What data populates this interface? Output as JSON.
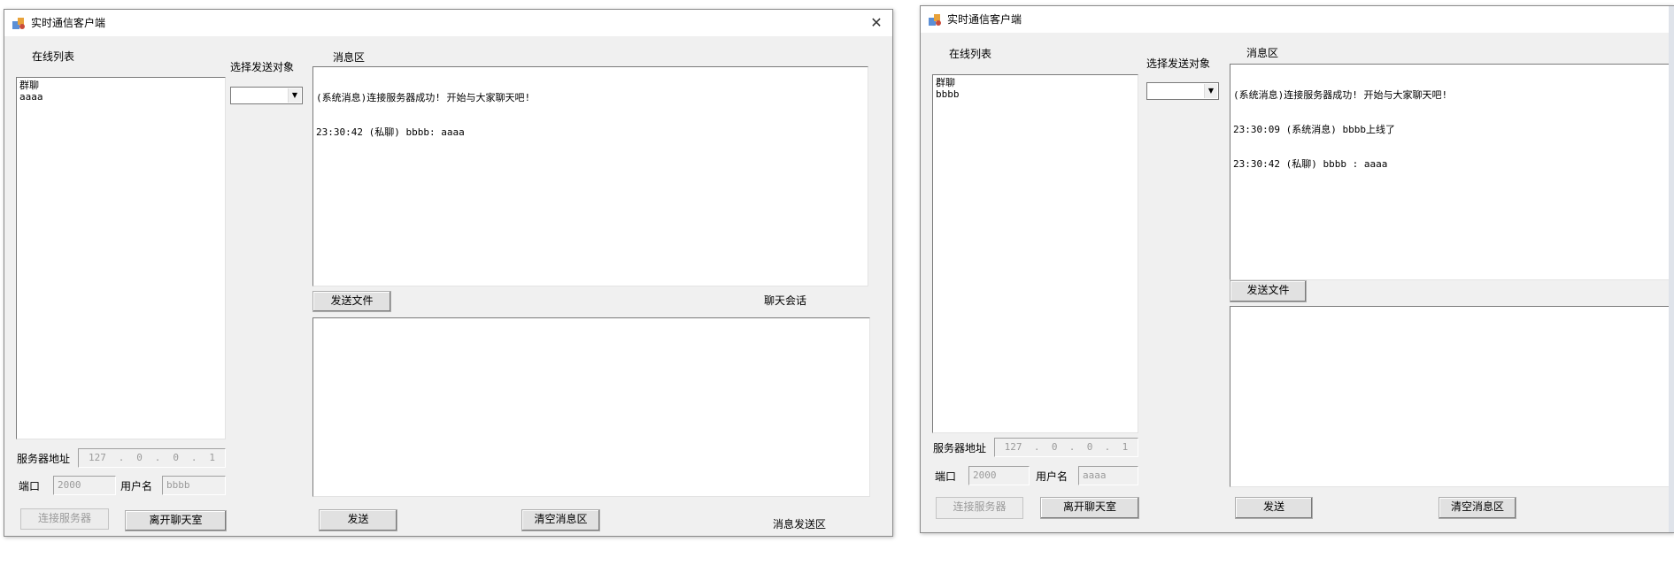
{
  "windows": [
    {
      "title": "实时通信客户端",
      "close_glyph": "✕",
      "labels": {
        "online_list": "在线列表",
        "select_target": "选择发送对象",
        "message_area": "消息区",
        "chat_session": "聊天会话",
        "server_address": "服务器地址",
        "port": "端口",
        "username": "用户名",
        "send_area": "消息发送区"
      },
      "online_users": [
        "群聊",
        "aaaa"
      ],
      "target_select": "",
      "messages": [
        "(系统消息)连接服务器成功! 开始与大家聊天吧!",
        "23:30:42 (私聊) bbbb: aaaa"
      ],
      "input_text": "",
      "ip_parts": [
        "127",
        "0",
        "0",
        "1"
      ],
      "port_value": "2000",
      "username_value": "bbbb",
      "buttons": {
        "send_file": "发送文件",
        "connect": "连接服务器",
        "leave": "离开聊天室",
        "send": "发送",
        "clear": "清空消息区"
      }
    },
    {
      "title": "实时通信客户端",
      "labels": {
        "online_list": "在线列表",
        "select_target": "选择发送对象",
        "message_area": "消息区",
        "server_address": "服务器地址",
        "port": "端口",
        "username": "用户名"
      },
      "online_users": [
        "群聊",
        "bbbb"
      ],
      "target_select": "",
      "messages": [
        "(系统消息)连接服务器成功! 开始与大家聊天吧!",
        "23:30:09 (系统消息) bbbb上线了",
        "23:30:42 (私聊) bbbb : aaaa"
      ],
      "input_text": "",
      "ip_parts": [
        "127",
        "0",
        "0",
        "1"
      ],
      "port_value": "2000",
      "username_value": "aaaa",
      "buttons": {
        "send_file": "发送文件",
        "connect": "连接服务器",
        "leave": "离开聊天室",
        "send": "发送",
        "clear": "清空消息区"
      }
    }
  ],
  "icons": {
    "app": "app-icon",
    "close": "close-icon",
    "dropdown": "dropdown-arrow-icon"
  }
}
